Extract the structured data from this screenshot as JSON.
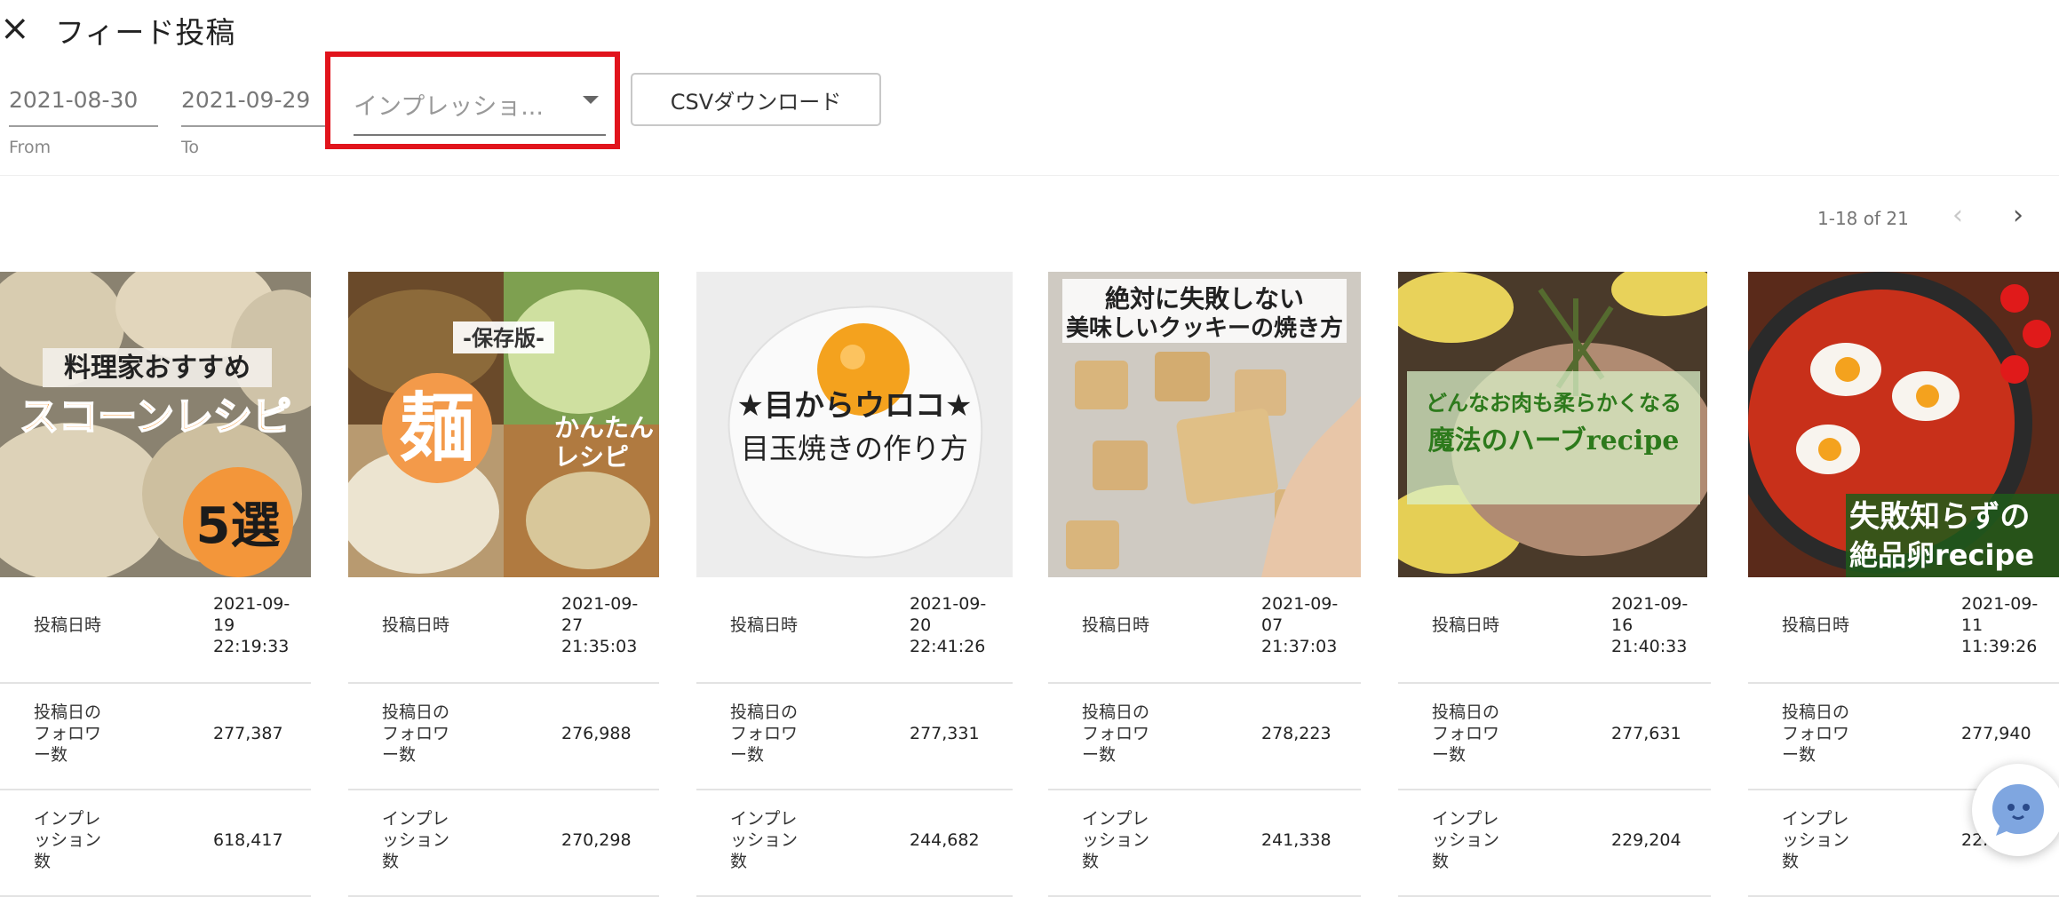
{
  "header": {
    "title": "フィード投稿",
    "close_icon": "close-icon"
  },
  "filters": {
    "from": {
      "value": "2021-08-30",
      "label": "From"
    },
    "to": {
      "value": "2021-09-29",
      "label": "To"
    },
    "metric_select": {
      "value": "インプレッショ..."
    },
    "csv_button": "CSVダウンロード",
    "highlight_color": "#e1141c"
  },
  "pagination": {
    "label": "1-18 of 21",
    "prev_icon": "chevron-left-icon",
    "next_icon": "chevron-right-icon"
  },
  "row_labels": {
    "date": "投稿日時",
    "followers": "投稿日の\nフォロワ\nー数",
    "impressions": "インプレ\nッション\n数"
  },
  "posts": [
    {
      "image_text": [
        "料理家おすすめ",
        "スコーンレシピ",
        "5選"
      ],
      "date": "2021-09-\n19\n22:19:33",
      "followers": "277,387",
      "impressions": "618,417"
    },
    {
      "image_text": [
        "-保存版-",
        "麺",
        "かんたん",
        "レシピ"
      ],
      "date": "2021-09-\n27\n21:35:03",
      "followers": "276,988",
      "impressions": "270,298"
    },
    {
      "image_text": [
        "★目からウロコ★",
        "目玉焼きの作り方"
      ],
      "date": "2021-09-\n20\n22:41:26",
      "followers": "277,331",
      "impressions": "244,682"
    },
    {
      "image_text": [
        "絶対に失敗しない",
        "美味しいクッキーの焼き方"
      ],
      "date": "2021-09-\n07\n21:37:03",
      "followers": "278,223",
      "impressions": "241,338"
    },
    {
      "image_text": [
        "どんなお肉も柔らかくなる",
        "魔法のハーブrecipe"
      ],
      "date": "2021-09-\n16\n21:40:33",
      "followers": "277,631",
      "impressions": "229,204"
    },
    {
      "image_text": [
        "失敗知らずの",
        "絶品卵recipe"
      ],
      "date": "2021-09-\n11\n11:39:26",
      "followers": "277,940",
      "impressions": "22..."
    }
  ],
  "chat_widget_icon": "chat-bot-icon"
}
